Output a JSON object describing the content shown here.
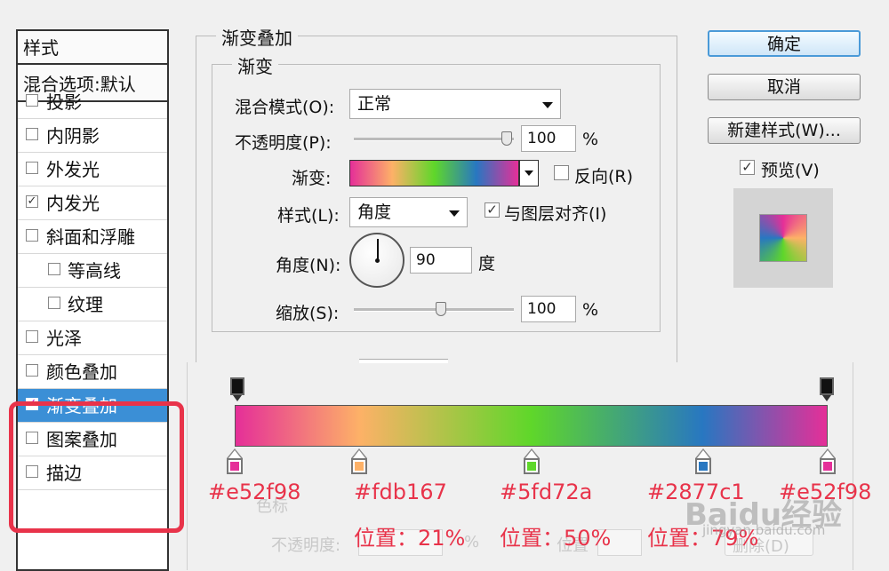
{
  "styles_panel": {
    "header": "样式",
    "blend_default": "混合选项:默认",
    "items": [
      {
        "label": "投影",
        "checked": false
      },
      {
        "label": "内阴影",
        "checked": false
      },
      {
        "label": "外发光",
        "checked": false
      },
      {
        "label": "内发光",
        "checked": true
      },
      {
        "label": "斜面和浮雕",
        "checked": false
      },
      {
        "label": "等高线",
        "checked": false
      },
      {
        "label": "纹理",
        "checked": false
      },
      {
        "label": "光泽",
        "checked": false
      },
      {
        "label": "颜色叠加",
        "checked": false
      },
      {
        "label": "渐变叠加",
        "checked": true,
        "selected": true
      },
      {
        "label": "图案叠加",
        "checked": false
      },
      {
        "label": "描边",
        "checked": false
      }
    ]
  },
  "section": {
    "title": "渐变叠加",
    "subtitle": "渐变",
    "blend_mode_label": "混合模式(O):",
    "blend_mode_value": "正常",
    "opacity_label": "不透明度(P):",
    "opacity_value": "100",
    "opacity_unit": "%",
    "opacity_level": 1.0,
    "gradient_label": "渐变:",
    "reverse_label": "反向(R)",
    "reverse_checked": false,
    "style_label": "样式(L):",
    "style_value": "角度",
    "align_label": "与图层对齐(I)",
    "align_checked": true,
    "angle_label": "角度(N):",
    "angle_value": "90",
    "angle_unit": "度",
    "scale_label": "缩放(S):",
    "scale_value": "100",
    "scale_unit": "%",
    "scale_level": 0.5
  },
  "buttons": {
    "ok": "确定",
    "cancel": "取消",
    "new_style": "新建样式(W)...",
    "preview_label": "预览(V)",
    "preview_checked": true
  },
  "gradient_stops": [
    {
      "hex": "#e52f98",
      "position": 0
    },
    {
      "hex": "#fdb167",
      "position": 21,
      "position_label": "位置：21%"
    },
    {
      "hex": "#5fd72a",
      "position": 50,
      "position_label": "位置：50%"
    },
    {
      "hex": "#2877c1",
      "position": 79,
      "position_label": "位置：79%"
    },
    {
      "hex": "#e52f98",
      "position": 100
    }
  ],
  "editor_faded": {
    "color_label": "色标",
    "opacity_label": "不透明度:",
    "percent": "%",
    "position_label": "位置",
    "delete_label": "删除(D)"
  },
  "watermark": {
    "text": "Baidu经验",
    "sub": "jingyan.baidu.com"
  },
  "colors": {
    "highlight": "#e8334a",
    "selection": "#3b8fd6",
    "annotation": "#e8334a"
  }
}
